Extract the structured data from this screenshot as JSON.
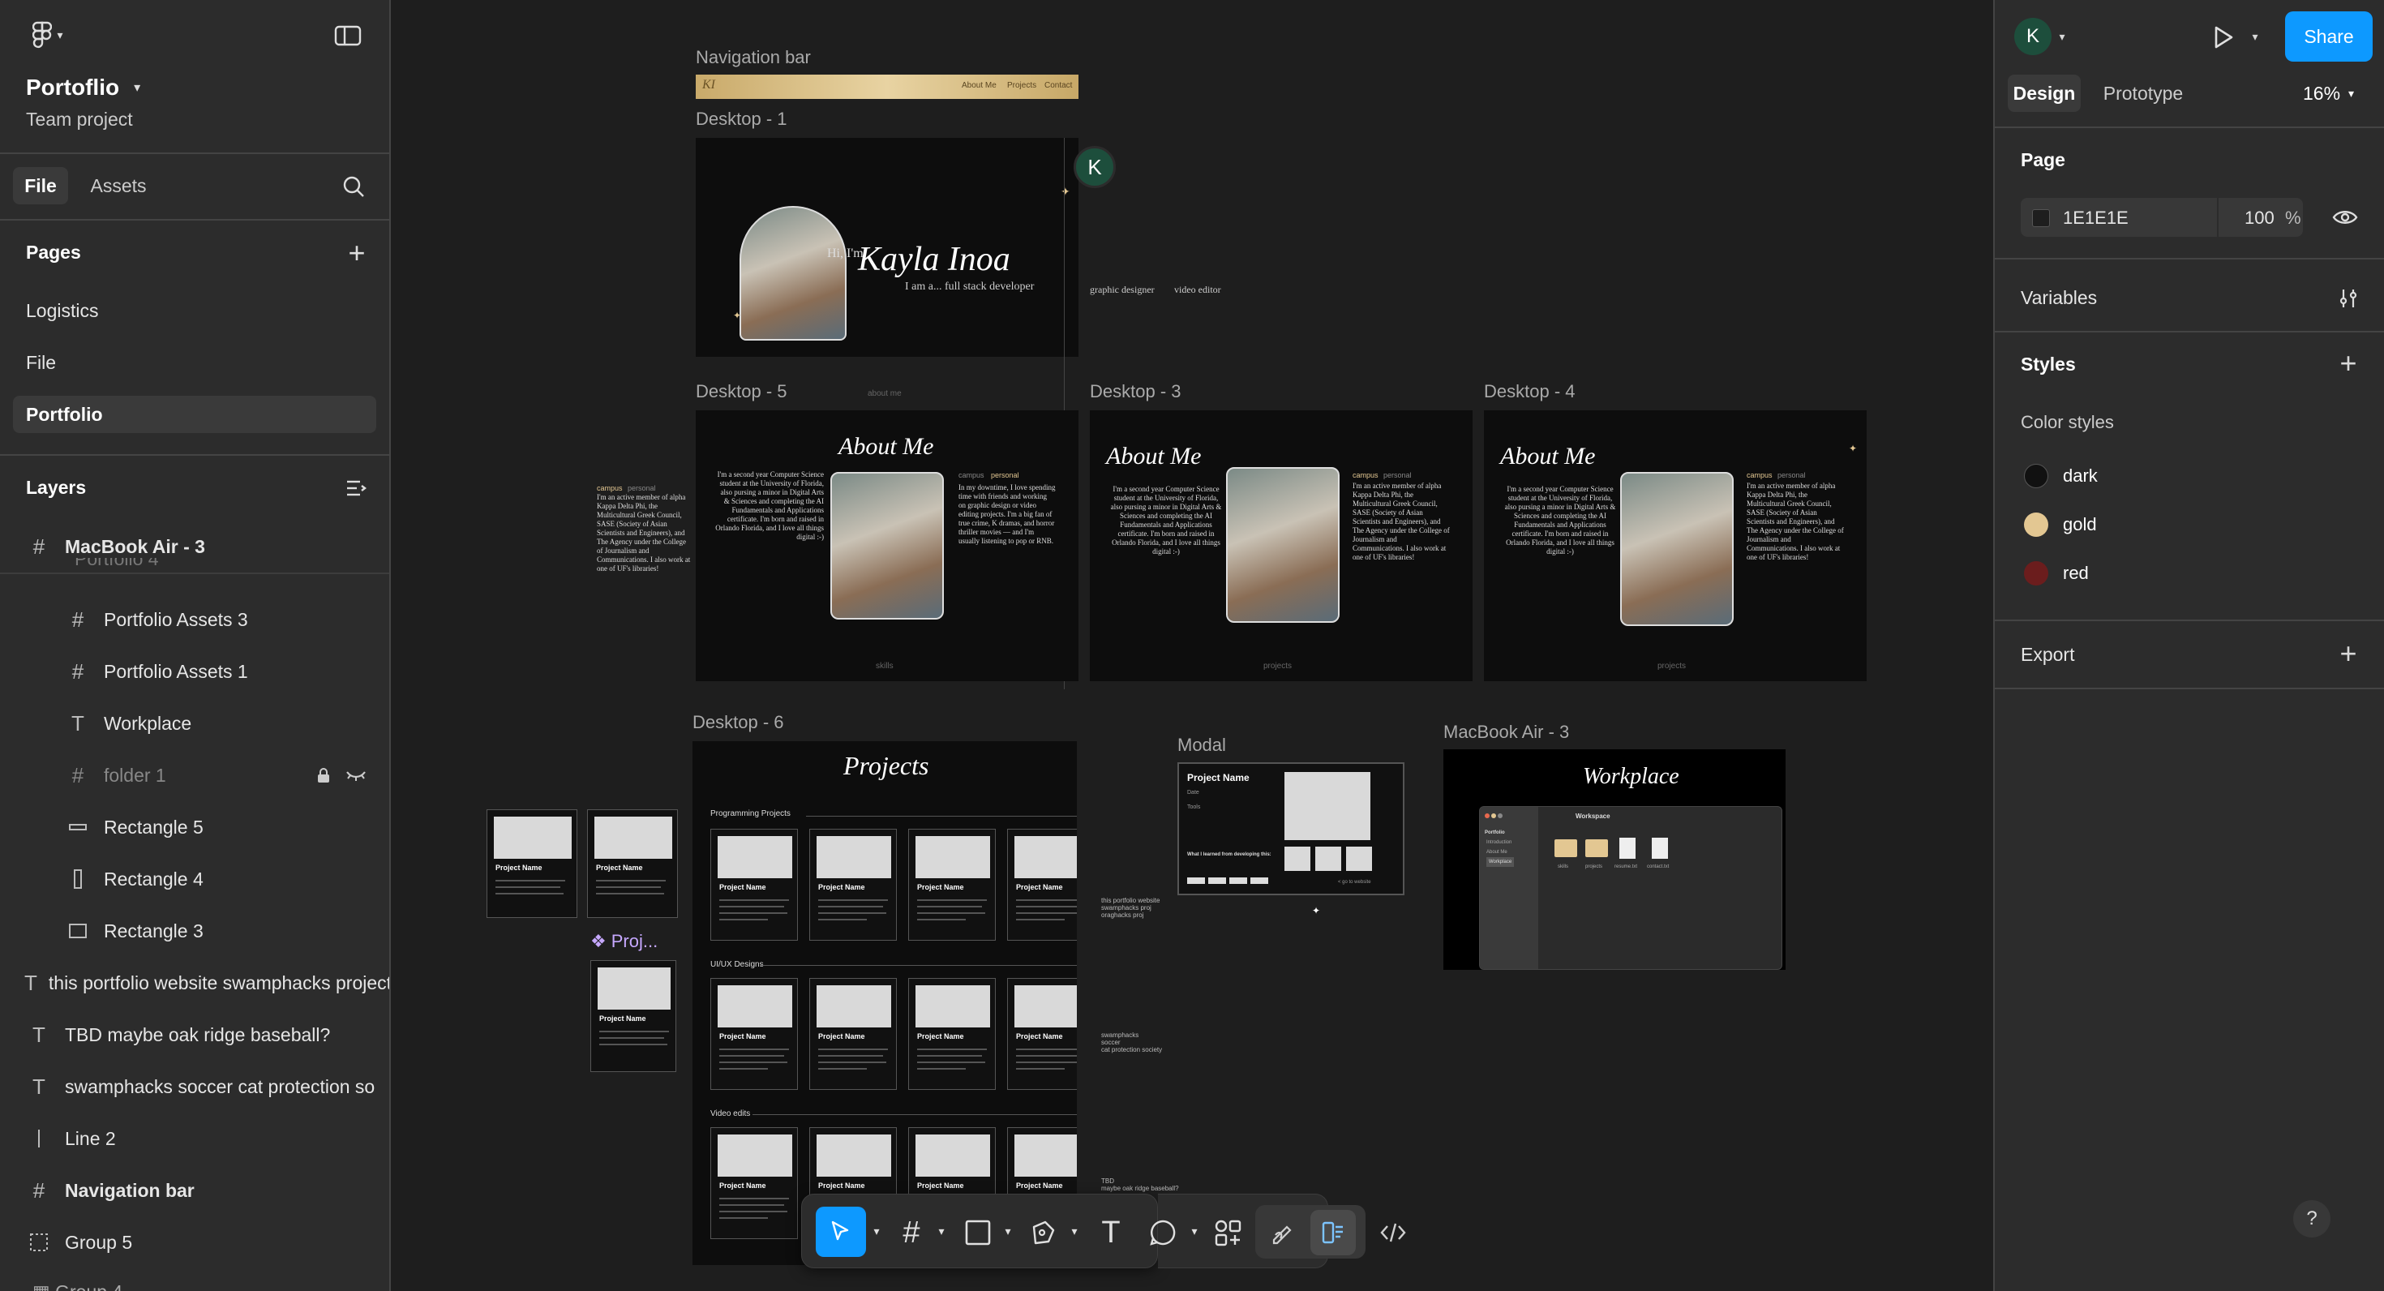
{
  "app": {
    "file_name": "Portoflio",
    "subtitle": "Team project"
  },
  "left_tabs": {
    "file": "File",
    "assets": "Assets"
  },
  "pages": {
    "title": "Pages",
    "items": [
      "Logistics",
      "File",
      "Portfolio"
    ],
    "selected": "Portfolio"
  },
  "layers": {
    "title": "Layers",
    "current_frame": "MacBook Air - 3",
    "items": [
      {
        "icon": "frame",
        "name": "Portfolio Assets 3"
      },
      {
        "icon": "frame",
        "name": "Portfolio Assets 1"
      },
      {
        "icon": "text",
        "name": "Workplace"
      },
      {
        "icon": "frame",
        "name": "folder 1"
      },
      {
        "icon": "rect-h",
        "name": "Rectangle 5"
      },
      {
        "icon": "rect-v",
        "name": "Rectangle 4"
      },
      {
        "icon": "rect",
        "name": "Rectangle 3"
      },
      {
        "icon": "text",
        "name": "this portfolio website swamphacks project"
      },
      {
        "icon": "text",
        "name": "TBD maybe oak ridge baseball?"
      },
      {
        "icon": "text",
        "name": "swamphacks soccer cat protection so"
      },
      {
        "icon": "line",
        "name": "Line 2"
      },
      {
        "icon": "frame",
        "name": "Navigation bar"
      },
      {
        "icon": "group",
        "name": "Group 5"
      }
    ]
  },
  "canvas": {
    "frames": {
      "nav": "Navigation bar",
      "d1": "Desktop - 1",
      "d5": "Desktop - 5",
      "d3": "Desktop - 3",
      "d4": "Desktop - 4",
      "d6": "Desktop - 6",
      "modal": "Modal",
      "mac": "MacBook Air - 3"
    },
    "nav_links": [
      "About Me",
      "Projects",
      "Contact"
    ],
    "hero": {
      "greeting": "Hi, I'm",
      "name": "Kayla Inoa",
      "role": "I am a... full stack developer",
      "roles_extra": [
        "graphic designer",
        "video editor"
      ],
      "hint": "about me"
    },
    "about": {
      "title": "About Me",
      "bio": "I'm a second year Computer Science student at the University of Florida, also pursing a minor in Digital Arts & Sciences and completing the AI Fundamentals and Applications certificate. I'm born and raised in Orlando Florida, and I love all things digital :-)",
      "tab_campus": "campus",
      "tab_personal": "personal",
      "campus_text": "I'm an active member of alpha Kappa Delta Phi, the Multicultural Greek Council, SASE (Society of Asian Scientists and Engineers), and The Agency under the College of Journalism and Communications. I also work at one of UF's libraries!",
      "personal_text": "In my downtime, I love spending time with friends and working on graphic design or video editing projects. I'm a big fan of true crime, K dramas, and horror thriller movies — and I'm usually listening to pop or RNB.",
      "skills_link": "skills",
      "projects_link": "projects"
    },
    "projects": {
      "title": "Projects",
      "sections": [
        "Programming Projects",
        "UI/UX Designs",
        "Video edits"
      ],
      "card_title": "Project Name",
      "card_desc": "Lorem ipsum dolor sit amet, consectetur adipiscing elit.",
      "notes1": [
        "this portfolio website",
        "swamphacks proj",
        "oraghacks proj"
      ],
      "notes2": [
        "swamphacks",
        "soccer",
        "cat protection society"
      ],
      "notes3": [
        "TBD",
        "maybe oak ridge baseball?"
      ],
      "component_label": "Proj..."
    },
    "modal": {
      "title": "Project Name",
      "sub1": "Date",
      "sub2": "Tools",
      "learned": "What I learned from developing this:",
      "link": "< go to website"
    },
    "workplace": {
      "title": "Workplace",
      "window_title": "Workspace",
      "sidebar": [
        "Portfolio",
        "Introduction",
        "About Me",
        "Workplace"
      ],
      "files": [
        "skills",
        "projects",
        "resume.txt",
        "contact.txt"
      ]
    },
    "avatar_letter": "K"
  },
  "toolbar": {
    "tools": [
      "move",
      "frame",
      "shape",
      "pen",
      "text",
      "comment",
      "actions",
      "draw",
      "dev-mode",
      "code"
    ]
  },
  "right": {
    "avatar_letter": "K",
    "share": "Share",
    "tab_design": "Design",
    "tab_prototype": "Prototype",
    "zoom": "16%",
    "page_section": "Page",
    "page_color": "1E1E1E",
    "page_opacity": "100",
    "percent": "%",
    "variables": "Variables",
    "styles": "Styles",
    "color_styles": "Color styles",
    "colors": [
      {
        "name": "dark",
        "hex": "#111111"
      },
      {
        "name": "gold",
        "hex": "#e3c792"
      },
      {
        "name": "red",
        "hex": "#6b1d1d"
      }
    ],
    "export": "Export",
    "help": "?"
  },
  "theme": {
    "accent": "#0d99ff",
    "panel": "#2c2c2c",
    "canvas": "#1e1e1e"
  }
}
